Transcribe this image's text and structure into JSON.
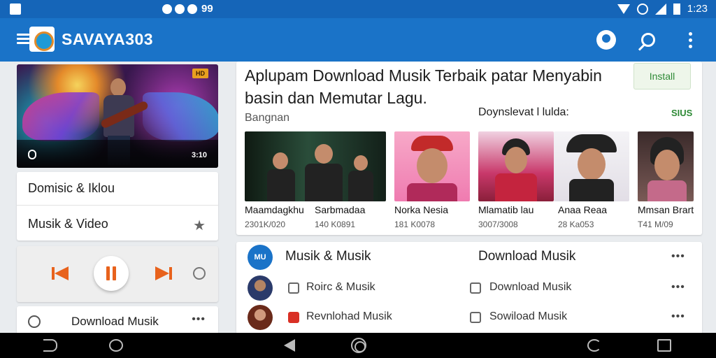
{
  "status_bar": {
    "notif_text": "99",
    "time": "1:23"
  },
  "app_bar": {
    "title": "SAVAYA303"
  },
  "left": {
    "hero_badge": "HD",
    "hero_duration": "3:10",
    "categories": [
      "Domisic & Iklou",
      "Musik & Video"
    ],
    "download_label": "Download Musik"
  },
  "main": {
    "title": "Aplupam Download Musik Terbaik patar Menyabin basin dan Memutar Lagu.",
    "install_label": "Install",
    "section_left": "Bangnan",
    "section_right": "Doynslevat l lulda:",
    "section_more": "SIUS",
    "cards": [
      {
        "name": "Maamdagkhu",
        "sub": "2301K/020"
      },
      {
        "name": "Sarbmadaa",
        "sub": "140 K0891"
      },
      {
        "name": "Norka Nesia",
        "sub": "181 K0078"
      },
      {
        "name": "Mlamatib lau",
        "sub": "3007/3008"
      },
      {
        "name": "Anaa Reaa",
        "sub": "28 Ka053"
      },
      {
        "name": "Mmsan Brart",
        "sub": "T41 M/09"
      }
    ]
  },
  "list": {
    "header_left": "Musik & Musik",
    "header_right": "Download Musik",
    "avatar_text": "MU",
    "rows": [
      {
        "left": "Roirc & Musik",
        "right": "Download Musik"
      },
      {
        "left": "Revnlohad Musik",
        "right": "Sowiload Musik"
      }
    ]
  },
  "colors": {
    "primary": "#1a73c8",
    "accent": "#e8621c",
    "green": "#2e8a36"
  }
}
